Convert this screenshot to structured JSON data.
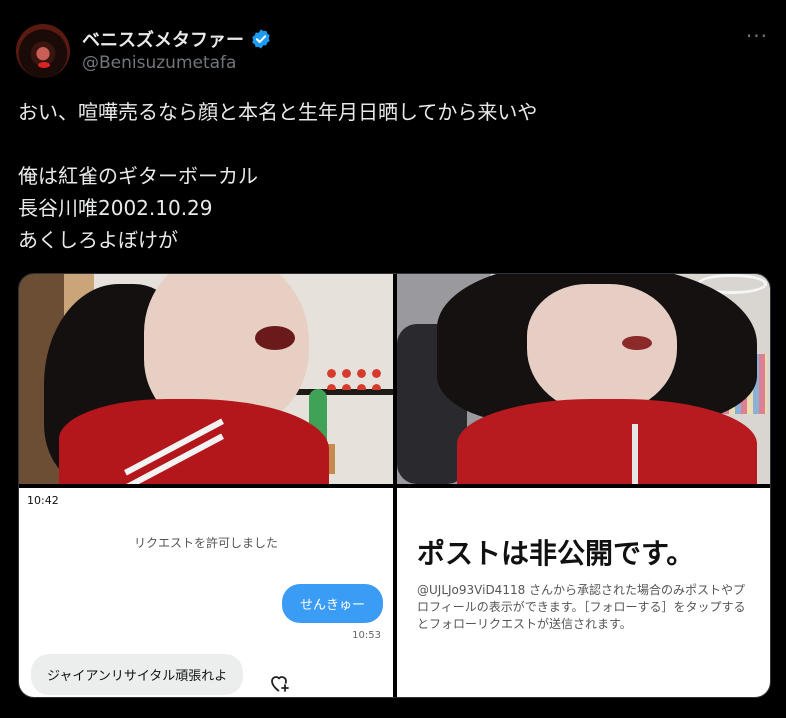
{
  "tweet": {
    "display_name": "ベニスズメタファー",
    "handle": "@Benisuzumetafa",
    "more_label": "···",
    "text": "おい、喧嘩売るなら顔と本名と生年月日晒してから来いや\n\n俺は紅雀のギターボーカル\n長谷川唯2002.10.29\nあくしろよぼけが",
    "verified_color": "#1d9bf0",
    "verified_icon": "verified-badge-icon"
  },
  "media": {
    "chat": {
      "time": "10:42",
      "system_message": "リクエストを許可しました",
      "outgoing_message": "せんきゅー",
      "outgoing_time": "10:53",
      "incoming_message": "ジャイアンリサイタル頑張れよ",
      "reaction_icon": "heart-plus-icon",
      "bubble_color": "#3b9cf5"
    },
    "private_notice": {
      "title": "ポストは非公開です。",
      "description": "@UJLJo93ViD4118 さんから承認された場合のみポストやプロフィールの表示ができます。［フォローする］をタップするとフォローリクエストが送信されます。"
    }
  },
  "colors": {
    "background": "#000000",
    "text": "#e7e9ea",
    "muted": "#71767b"
  }
}
